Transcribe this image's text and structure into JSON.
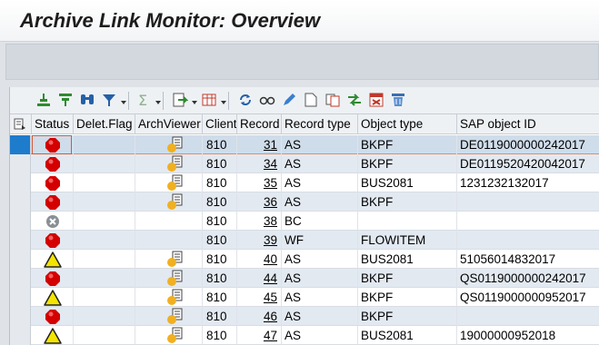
{
  "window": {
    "title": "Archive Link Monitor: Overview"
  },
  "grid_toolbar": {
    "icons": [
      "sort-ascending-icon",
      "sort-descending-icon",
      "find-icon",
      "filter-icon",
      "sum-icon",
      "export-icon",
      "layout-icon",
      "refresh-icon",
      "display-icon",
      "edit-icon",
      "new-document-icon",
      "copy-icon",
      "transfer-icon",
      "delete-entry-icon",
      "trash-icon"
    ]
  },
  "columns": {
    "status": "Status",
    "delet_flag": "Delet.Flag",
    "archviewer": "ArchViewer",
    "client": "Client",
    "record": "Record",
    "record_type": "Record type",
    "object_type": "Object type",
    "sap_object_id": "SAP object ID"
  },
  "rows": [
    {
      "status": "error",
      "viewer": true,
      "client": "810",
      "record": "31",
      "record_type": "AS",
      "object_type": "BKPF",
      "sap_object_id": "DE0119000000242017"
    },
    {
      "status": "error",
      "viewer": true,
      "client": "810",
      "record": "34",
      "record_type": "AS",
      "object_type": "BKPF",
      "sap_object_id": "DE0119520420042017"
    },
    {
      "status": "error",
      "viewer": true,
      "client": "810",
      "record": "35",
      "record_type": "AS",
      "object_type": "BUS2081",
      "sap_object_id": "1231232132017"
    },
    {
      "status": "error",
      "viewer": true,
      "client": "810",
      "record": "36",
      "record_type": "AS",
      "object_type": "BKPF",
      "sap_object_id": ""
    },
    {
      "status": "cancelled",
      "viewer": false,
      "client": "810",
      "record": "38",
      "record_type": "BC",
      "object_type": "",
      "sap_object_id": ""
    },
    {
      "status": "error",
      "viewer": false,
      "client": "810",
      "record": "39",
      "record_type": "WF",
      "object_type": "FLOWITEM",
      "sap_object_id": ""
    },
    {
      "status": "warning",
      "viewer": true,
      "client": "810",
      "record": "40",
      "record_type": "AS",
      "object_type": "BUS2081",
      "sap_object_id": "51056014832017"
    },
    {
      "status": "error",
      "viewer": true,
      "client": "810",
      "record": "44",
      "record_type": "AS",
      "object_type": "BKPF",
      "sap_object_id": "QS0119000000242017"
    },
    {
      "status": "warning",
      "viewer": true,
      "client": "810",
      "record": "45",
      "record_type": "AS",
      "object_type": "BKPF",
      "sap_object_id": "QS0119000000952017"
    },
    {
      "status": "error",
      "viewer": true,
      "client": "810",
      "record": "46",
      "record_type": "AS",
      "object_type": "BKPF",
      "sap_object_id": ""
    },
    {
      "status": "warning",
      "viewer": true,
      "client": "810",
      "record": "47",
      "record_type": "AS",
      "object_type": "BUS2081",
      "sap_object_id": "19000000952018"
    }
  ],
  "colors": {
    "accent": "#1e7ccd",
    "error": "#d40000",
    "warning": "#f4e400",
    "row_alt": "#e2e9f1"
  }
}
